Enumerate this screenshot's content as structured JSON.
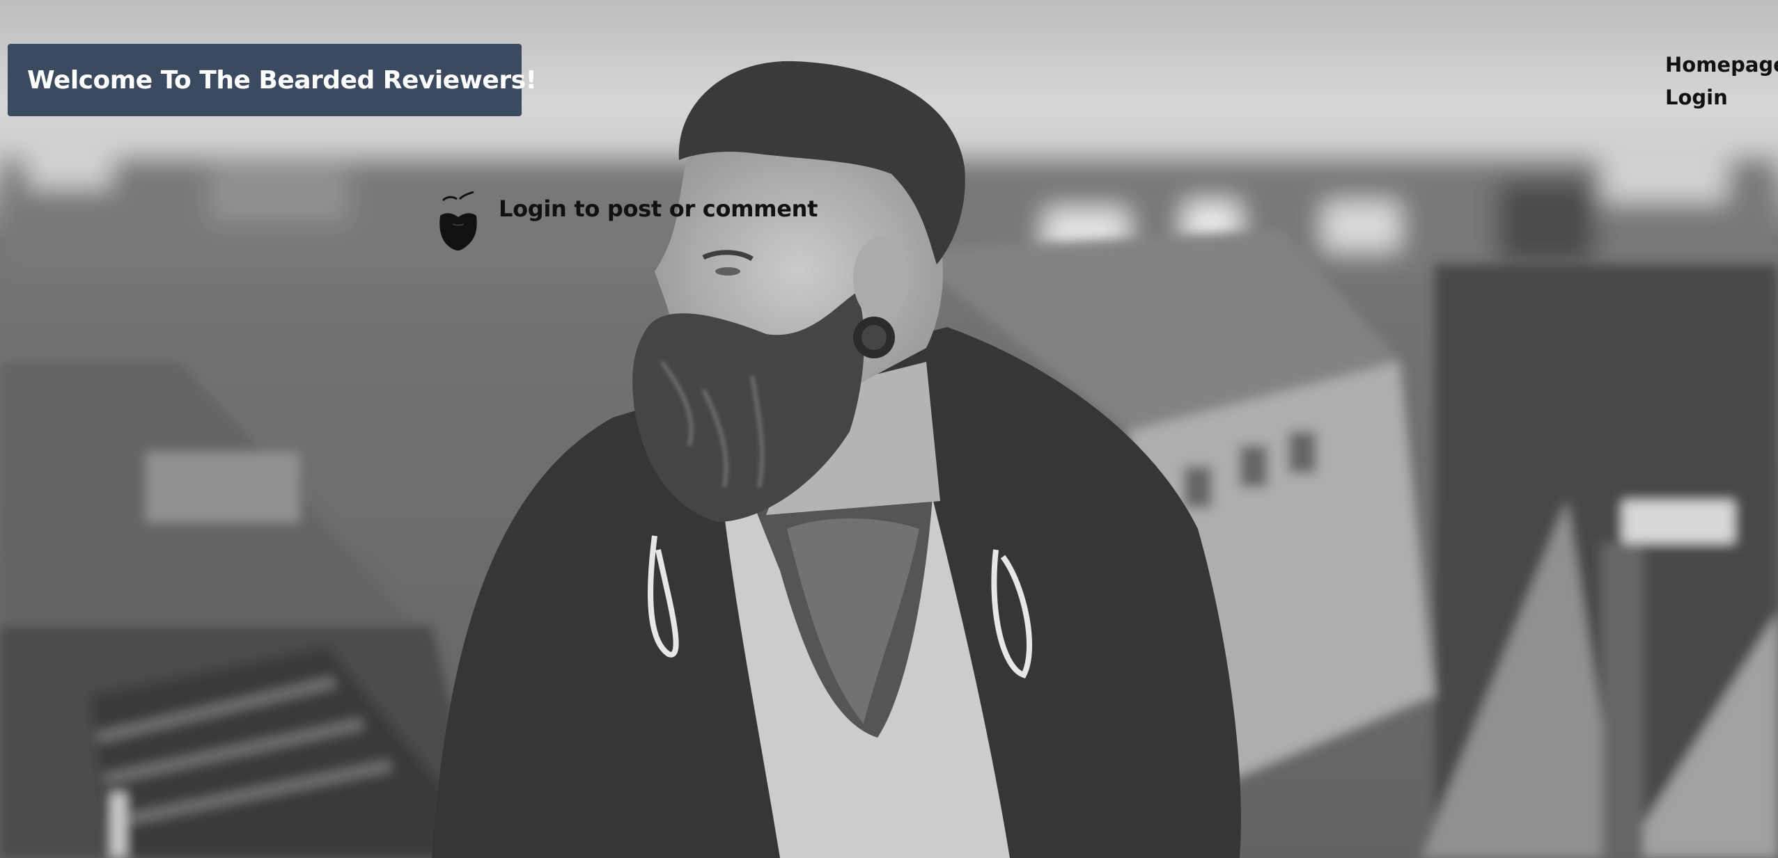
{
  "header": {
    "title": "Welcome To The Bearded Reviewers!"
  },
  "nav": {
    "items": [
      {
        "label": "Homepage"
      },
      {
        "label": "Login"
      }
    ]
  },
  "main": {
    "login_prompt": "Login to post or comment",
    "prompt_icon": "beard-icon"
  },
  "background": {
    "subject": "hero-photo",
    "tone": "grayscale"
  },
  "colors": {
    "banner": "#3b4a5e",
    "banner_text": "#ffffff",
    "text": "#111111"
  }
}
